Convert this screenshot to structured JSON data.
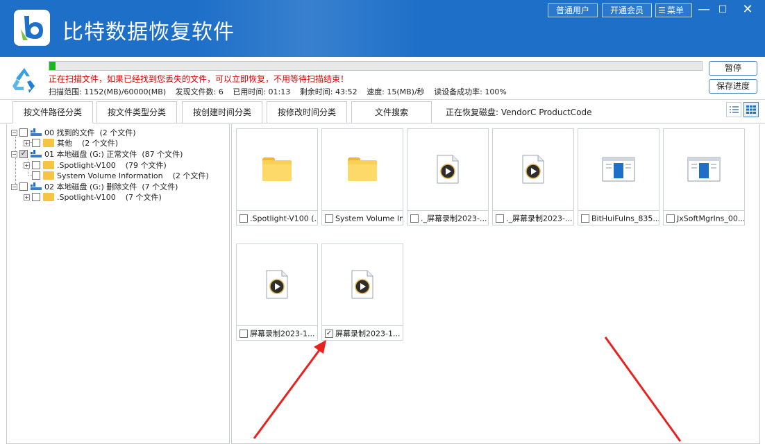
{
  "app": {
    "title": "比特数据恢复软件",
    "top_buttons": [
      "普通用户",
      "开通会员",
      "菜单"
    ],
    "window_controls": [
      "minimize-icon",
      "maximize-icon",
      "close-icon"
    ],
    "brand_color": "#1d6fc8"
  },
  "scan": {
    "progress_fraction": 0.01,
    "message": "正在扫描文件，如果已经找到您丢失的文件，可以立即恢复，不用等待扫描结束！",
    "range": "扫描范围: 1152(MB)/60000(MB)",
    "found": "发现文件数: 6",
    "elapsed": "已用时间: 01:13",
    "remaining": "剩余时间: 43:52",
    "speed": "速度: 15(MB)/秒",
    "read_rate": "读设备成功率: 100%",
    "pause_label": "暂停",
    "save_progress_label": "保存进度"
  },
  "tabs": {
    "items": [
      "按文件路径分类",
      "按文件类型分类",
      "按创建时间分类",
      "按修改时间分类",
      "文件搜索"
    ],
    "active_index": 0,
    "recovering_text": "正在恢复磁盘: VendorC ProductCode"
  },
  "tree": [
    {
      "label": "00 找到的文件",
      "count": "(2 个文件)"
    },
    {
      "label": "其他",
      "count": "(2 个文件)"
    },
    {
      "label": "01 本地磁盘 (G:) 正常文件",
      "count": "(87 个文件)"
    },
    {
      "label": ".Spotlight-V100",
      "count": "(79 个文件)"
    },
    {
      "label": "System Volume Information",
      "count": "(2 个文件)"
    },
    {
      "label": "02 本地磁盘 (G:) 删除文件",
      "count": "(7 个文件)"
    },
    {
      "label": ".Spotlight-V100",
      "count": "(7 个文件)"
    }
  ],
  "files": [
    {
      "name": ".Spotlight-V100 (...",
      "icon": "folder-icon",
      "checked": false
    },
    {
      "name": "System Volume In...",
      "icon": "folder-icon",
      "checked": false
    },
    {
      "name": "._屏幕录制2023-...",
      "icon": "video-file-icon",
      "checked": false
    },
    {
      "name": "._屏幕录制2023-...",
      "icon": "video-file-icon",
      "checked": false
    },
    {
      "name": "BitHuiFuIns_835....",
      "icon": "app-window-icon",
      "checked": false
    },
    {
      "name": "JxSoftMgrIns_00...",
      "icon": "app-window-icon",
      "checked": false
    },
    {
      "name": "屏幕录制2023-1...",
      "icon": "video-file-icon",
      "checked": false
    },
    {
      "name": "屏幕录制2023-1...",
      "icon": "video-file-icon",
      "checked": true
    }
  ],
  "annotation_color": "#e8231f"
}
